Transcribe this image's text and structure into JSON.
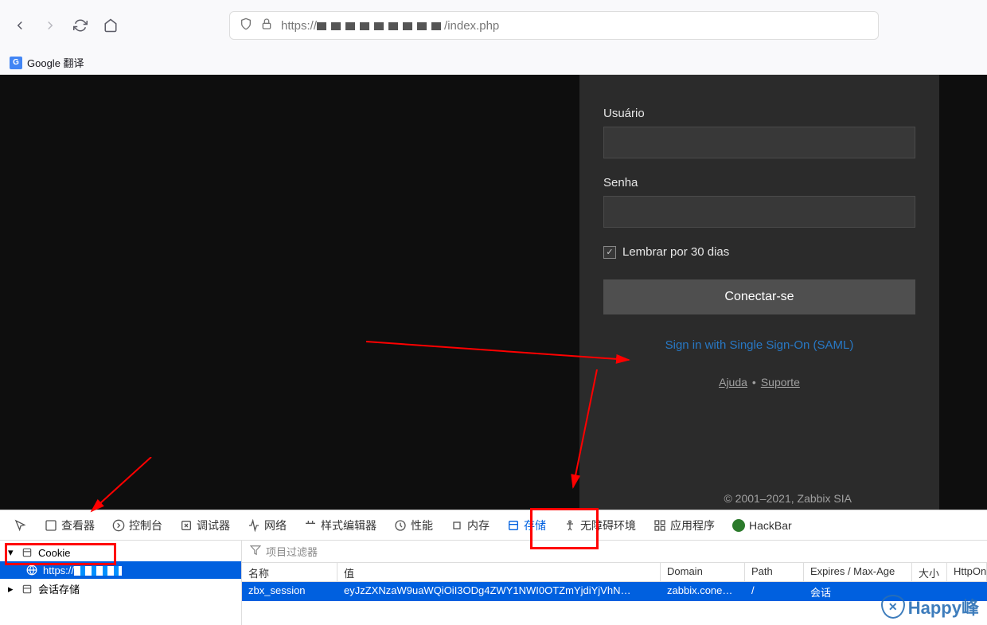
{
  "browser": {
    "url_prefix": "https://",
    "url_suffix": "/index.php",
    "bookmark_translate": "Google 翻译"
  },
  "login": {
    "user_label": "Usuário",
    "pass_label": "Senha",
    "remember": "Lembrar por 30 dias",
    "connect": "Conectar-se",
    "saml": "Sign in with Single Sign-On (SAML)",
    "help": "Ajuda",
    "support": "Suporte",
    "copyright": "© 2001–2021, Zabbix SIA"
  },
  "devtools": {
    "tabs": {
      "inspector": "查看器",
      "console": "控制台",
      "debugger": "调试器",
      "network": "网络",
      "styleeditor": "样式编辑器",
      "performance": "性能",
      "memory": "内存",
      "storage": "存储",
      "accessibility": "无障碍环境",
      "application": "应用程序",
      "hackbar": "HackBar"
    },
    "sidebar": {
      "cookie": "Cookie",
      "https": "https://",
      "session_storage": "会话存储"
    },
    "filter_placeholder": "项目过滤器",
    "columns": {
      "name": "名称",
      "value": "值",
      "domain": "Domain",
      "path": "Path",
      "expires": "Expires / Max-Age",
      "size": "大小",
      "httponly": "HttpOn"
    },
    "row": {
      "name": "zbx_session",
      "value": "eyJzZXNzaW9uaWQiOiI3ODg4ZWY1NWI0OTZmYjdiYjVhN…",
      "domain": "zabbix.cone…",
      "path": "/",
      "expires": "会话"
    }
  },
  "watermark": "Happy峰"
}
